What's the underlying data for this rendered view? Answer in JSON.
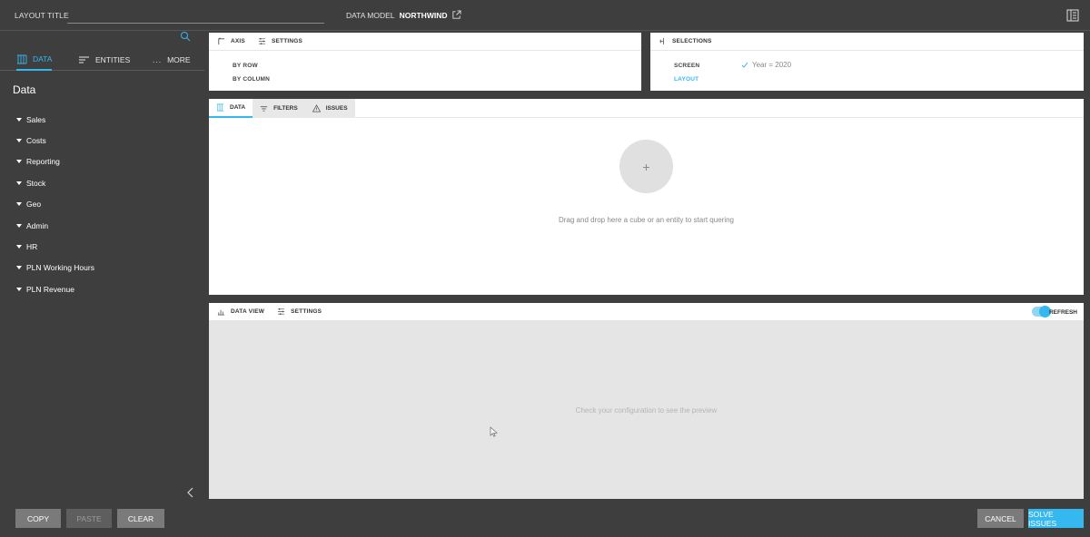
{
  "topbar": {
    "layout_title_label": "LAYOUT TITLE",
    "layout_title_value": "",
    "data_model_label": "DATA MODEL",
    "data_model_name": "NORTHWIND"
  },
  "sidebar": {
    "tabs": [
      {
        "label": "DATA",
        "icon": "cube-icon",
        "active": true
      },
      {
        "label": "ENTITIES",
        "icon": "list-lines-icon",
        "active": false
      },
      {
        "label": "MORE",
        "icon": "ellipsis-icon",
        "active": false
      }
    ],
    "heading": "Data",
    "items": [
      {
        "label": "Sales"
      },
      {
        "label": "Costs"
      },
      {
        "label": "Reporting"
      },
      {
        "label": "Stock"
      },
      {
        "label": "Geo"
      },
      {
        "label": "Admin"
      },
      {
        "label": "HR"
      },
      {
        "label": "PLN Working Hours"
      },
      {
        "label": "PLN Revenue"
      }
    ]
  },
  "axis_panel": {
    "tabs": [
      {
        "label": "AXIS"
      },
      {
        "label": "SETTINGS"
      }
    ],
    "by_row": "BY ROW",
    "by_column": "BY COLUMN"
  },
  "selections_panel": {
    "title": "SELECTIONS",
    "screen": "SCREEN",
    "layout": "LAYOUT",
    "screen_value": "Year = 2020"
  },
  "data_query": {
    "tabs": [
      {
        "label": "DATA",
        "active": true
      },
      {
        "label": "FILTERS",
        "active": false
      },
      {
        "label": "ISSUES",
        "active": false
      }
    ],
    "add_symbol": "+",
    "hint": "Drag and drop here a cube or an entity to start quering"
  },
  "data_view": {
    "tabs": [
      {
        "label": "DATA VIEW"
      },
      {
        "label": "SETTINGS"
      }
    ],
    "refresh_label": "REFRESH",
    "refresh_on": true,
    "hint": "Check your configuration to see the preview"
  },
  "footer": {
    "copy": "COPY",
    "paste": "PASTE",
    "clear": "CLEAR",
    "cancel": "CANCEL",
    "solve": "SOLVE ISSUES"
  },
  "colors": {
    "accent": "#35b7ef",
    "background": "#3e3e3e"
  }
}
